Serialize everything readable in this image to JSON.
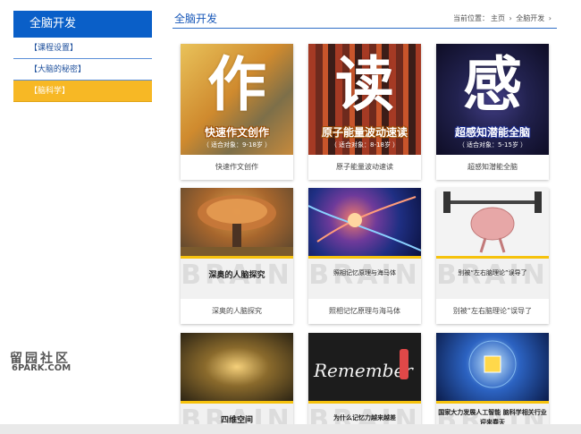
{
  "sidebar": {
    "title": "全脑开发",
    "items": [
      {
        "label": "【课程设置】"
      },
      {
        "label": "【大脑的秘密】"
      },
      {
        "label": "【脑科学】"
      }
    ]
  },
  "header": {
    "title": "全脑开发",
    "breadcrumb": {
      "prefix": "当前位置：",
      "home": "主页",
      "sep": "›",
      "current": "全脑开发",
      "sep2": "›"
    }
  },
  "cards": [
    {
      "char": "作",
      "subtitle": "快速作文创作",
      "audience": "（ 适合对象：9-18岁 ）",
      "caption": "快速作文创作"
    },
    {
      "char": "读",
      "subtitle": "原子能量波动速读",
      "audience": "（ 适合对象：8-18岁 ）",
      "caption": "原子能量波动速读"
    },
    {
      "char": "感",
      "subtitle": "超感知潜能全脑",
      "audience": "（ 适合对象：5-15岁 ）",
      "caption": "超感知潜能全脑"
    },
    {
      "band": "深奥的人脑探究",
      "brand": "BRAIN",
      "caption": "深奥的人脑探究"
    },
    {
      "band": "照相记忆原理与海马体",
      "brand": "BRAIN",
      "caption": "照相记忆原理与海马体"
    },
    {
      "band": "别被“左右脑理论”误导了",
      "brand": "BRAIN",
      "caption": "别被“左右脑理论”误导了"
    },
    {
      "band": "四维空间",
      "brand": "BRAIN"
    },
    {
      "band": "为什么记忆力越来越差",
      "brand": "BRAIN",
      "photo_text": "Remember"
    },
    {
      "band": "国家大力发展人工智能 脑科学相关行业迎来春天",
      "brand": "BRAIN"
    }
  ],
  "watermark": {
    "line1": "留园社区",
    "line2": "6PARK.COM"
  }
}
